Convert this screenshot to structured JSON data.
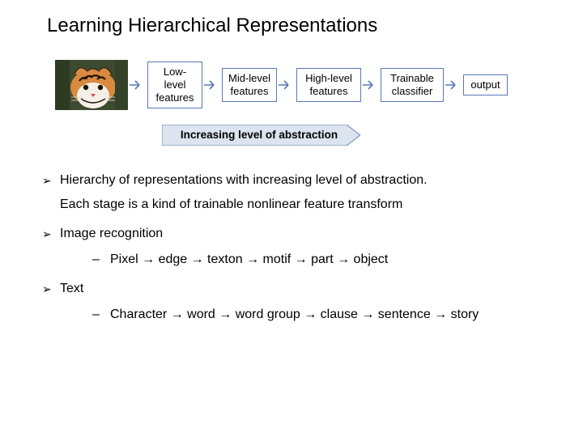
{
  "title": "Learning Hierarchical Representations",
  "flow": {
    "image_alt": "tiger",
    "boxes": [
      "Low-level features",
      "Mid-level features",
      "High-level features",
      "Trainable classifier",
      "output"
    ],
    "banner": "Increasing level of abstraction"
  },
  "bullets": {
    "b1_line1": "Hierarchy of representations with increasing level of abstraction.",
    "b1_line2": "Each stage is a kind of trainable nonlinear feature transform",
    "b2": "Image recognition",
    "b2_sub": "Pixel → edge → texton → motif → part → object",
    "b3": "Text",
    "b3_sub": "Character → word → word group → clause → sentence → story"
  },
  "colors": {
    "box_border": "#567ab6",
    "banner_fill": "#dbe4ef"
  }
}
